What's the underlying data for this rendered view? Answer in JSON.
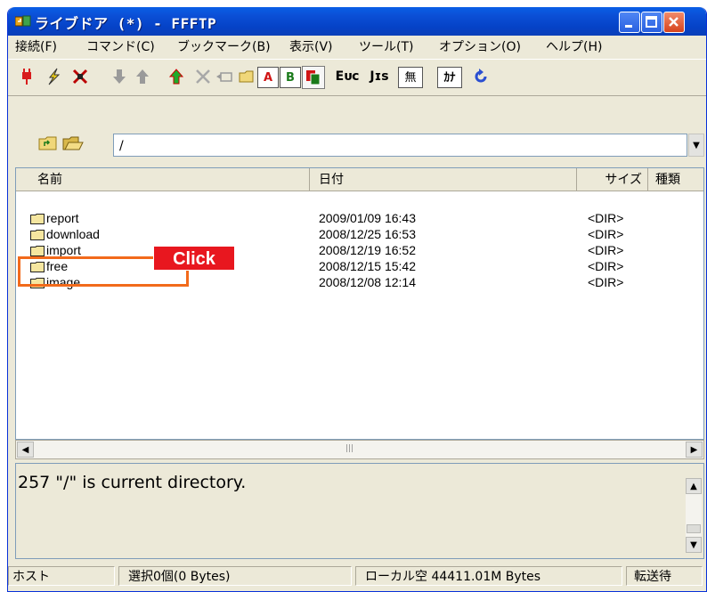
{
  "window": {
    "title": "ライブドア (*) - FFFTP"
  },
  "menu": [
    "接続(F)",
    "コマンド(C)",
    "ブックマーク(B)",
    "表示(V)",
    "ツール(T)",
    "オプション(O)",
    "ヘルプ(H)"
  ],
  "toolbar": {
    "ascii_label": "A",
    "binary_label": "B",
    "euc_label": "Eᴜᴄ",
    "jis_label": "Jɪs",
    "no_convert_label": "無",
    "kana_label": "ｶﾅ"
  },
  "path": {
    "value": "/"
  },
  "columns": {
    "name": "名前",
    "date": "日付",
    "size": "サイズ",
    "type": "種類"
  },
  "files": [
    {
      "name": "report",
      "date": "2009/01/09 16:43",
      "size": "<DIR>"
    },
    {
      "name": "download",
      "date": "2008/12/25 16:53",
      "size": "<DIR>"
    },
    {
      "name": "import",
      "date": "2008/12/19 16:52",
      "size": "<DIR>"
    },
    {
      "name": "free",
      "date": "2008/12/15 15:42",
      "size": "<DIR>"
    },
    {
      "name": "image",
      "date": "2008/12/08 12:14",
      "size": "<DIR>"
    }
  ],
  "log": {
    "text": "257 \"/\" is current directory."
  },
  "status": {
    "host": "ホスト",
    "selection": "選択0個(0 Bytes)",
    "local_free": "ローカル空 44411.01M Bytes",
    "transfer": "転送待"
  },
  "annotation": {
    "label": "Click"
  },
  "colors": {
    "titlebar": "#0542c7",
    "callout_box": "#f26a1b",
    "callout_label": "#e8171f"
  }
}
